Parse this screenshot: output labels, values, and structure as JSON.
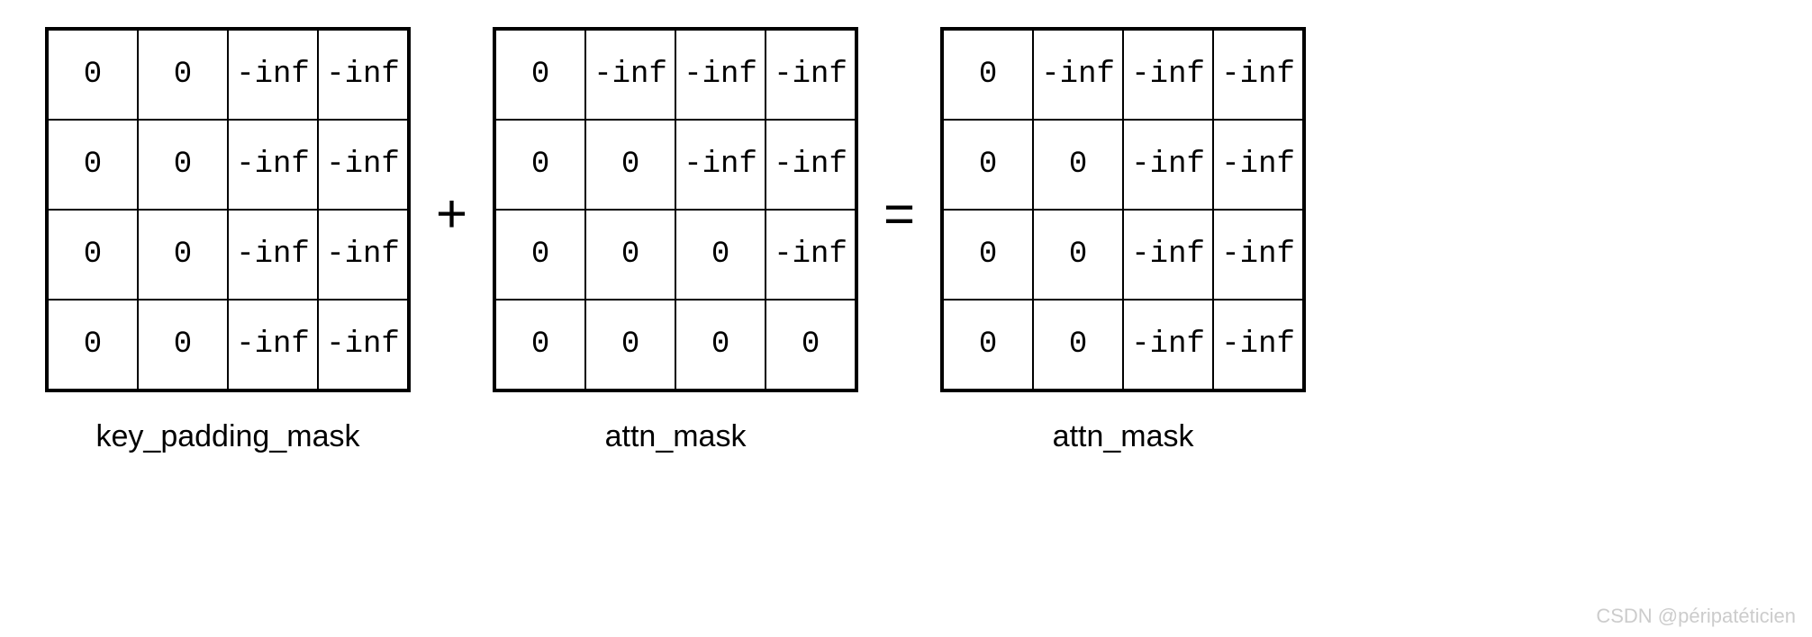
{
  "matrices": [
    {
      "label": "key_padding_mask",
      "cells": [
        [
          "0",
          "0",
          "-inf",
          "-inf"
        ],
        [
          "0",
          "0",
          "-inf",
          "-inf"
        ],
        [
          "0",
          "0",
          "-inf",
          "-inf"
        ],
        [
          "0",
          "0",
          "-inf",
          "-inf"
        ]
      ]
    },
    {
      "label": "attn_mask",
      "cells": [
        [
          "0",
          "-inf",
          "-inf",
          "-inf"
        ],
        [
          "0",
          "0",
          "-inf",
          "-inf"
        ],
        [
          "0",
          "0",
          "0",
          "-inf"
        ],
        [
          "0",
          "0",
          "0",
          "0"
        ]
      ]
    },
    {
      "label": "attn_mask",
      "cells": [
        [
          "0",
          "-inf",
          "-inf",
          "-inf"
        ],
        [
          "0",
          "0",
          "-inf",
          "-inf"
        ],
        [
          "0",
          "0",
          "-inf",
          "-inf"
        ],
        [
          "0",
          "0",
          "-inf",
          "-inf"
        ]
      ]
    }
  ],
  "operators": {
    "plus": "+",
    "equals": "="
  },
  "watermark": "CSDN @péripatéticien"
}
